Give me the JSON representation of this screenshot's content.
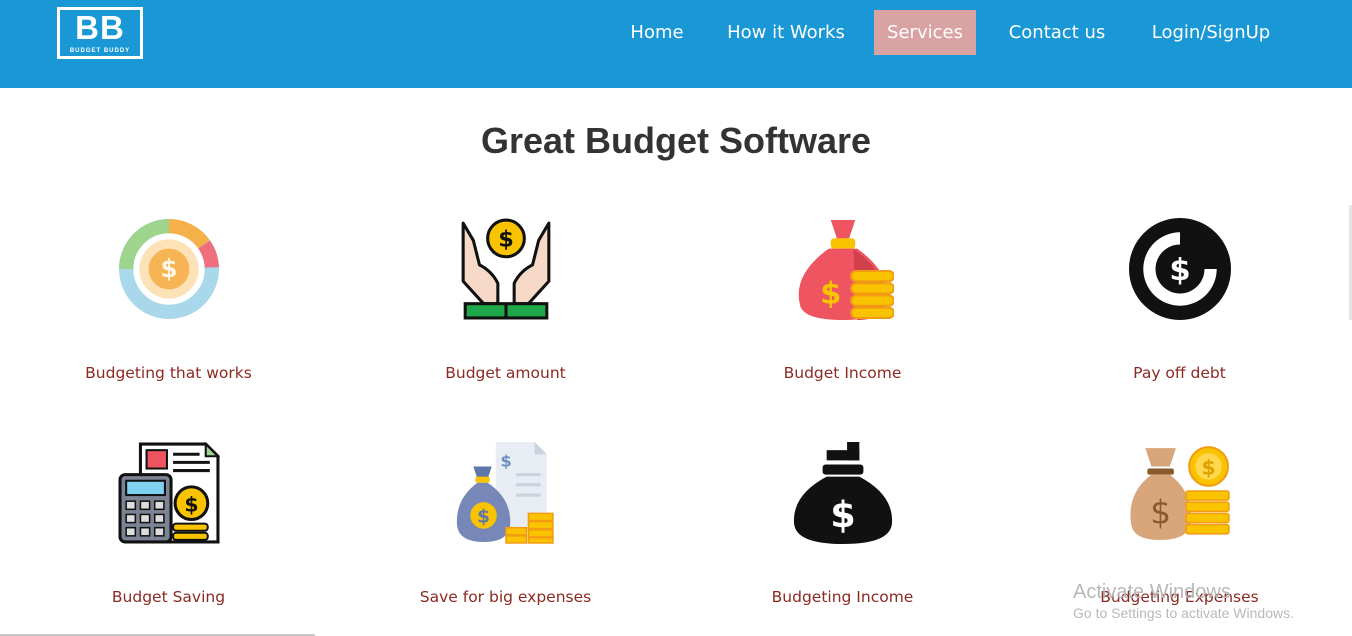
{
  "header": {
    "logo_letters": "BB",
    "logo_tagline": "BUDGET BUDDY",
    "nav": [
      {
        "label": "Home",
        "active": false
      },
      {
        "label": "How it Works",
        "active": false
      },
      {
        "label": "Services",
        "active": true
      },
      {
        "label": "Contact us",
        "active": false
      },
      {
        "label": "Login/SignUp",
        "active": false
      }
    ]
  },
  "main": {
    "title": "Great Budget Software",
    "services": [
      {
        "label": "Budgeting that works",
        "icon": "donut-chart-coin-icon"
      },
      {
        "label": "Budget amount",
        "icon": "hands-holding-coin-icon"
      },
      {
        "label": "Budget Income",
        "icon": "money-bag-coins-icon"
      },
      {
        "label": "Pay off debt",
        "icon": "circular-dollar-icon"
      },
      {
        "label": "Budget Saving",
        "icon": "calculator-invoice-icon"
      },
      {
        "label": "Save for big expenses",
        "icon": "money-bag-document-icon"
      },
      {
        "label": "Budgeting Income",
        "icon": "black-money-bag-icon"
      },
      {
        "label": "Budgeting Expenses",
        "icon": "brown-money-bag-coins-icon"
      }
    ]
  },
  "watermark": {
    "title": "Activate Windows",
    "subtitle": "Go to Settings to activate Windows."
  },
  "colors": {
    "header_bg": "#1a98d6",
    "active_nav_bg": "#d9a3a3",
    "card_label": "#8b2a22",
    "title": "#333333"
  }
}
